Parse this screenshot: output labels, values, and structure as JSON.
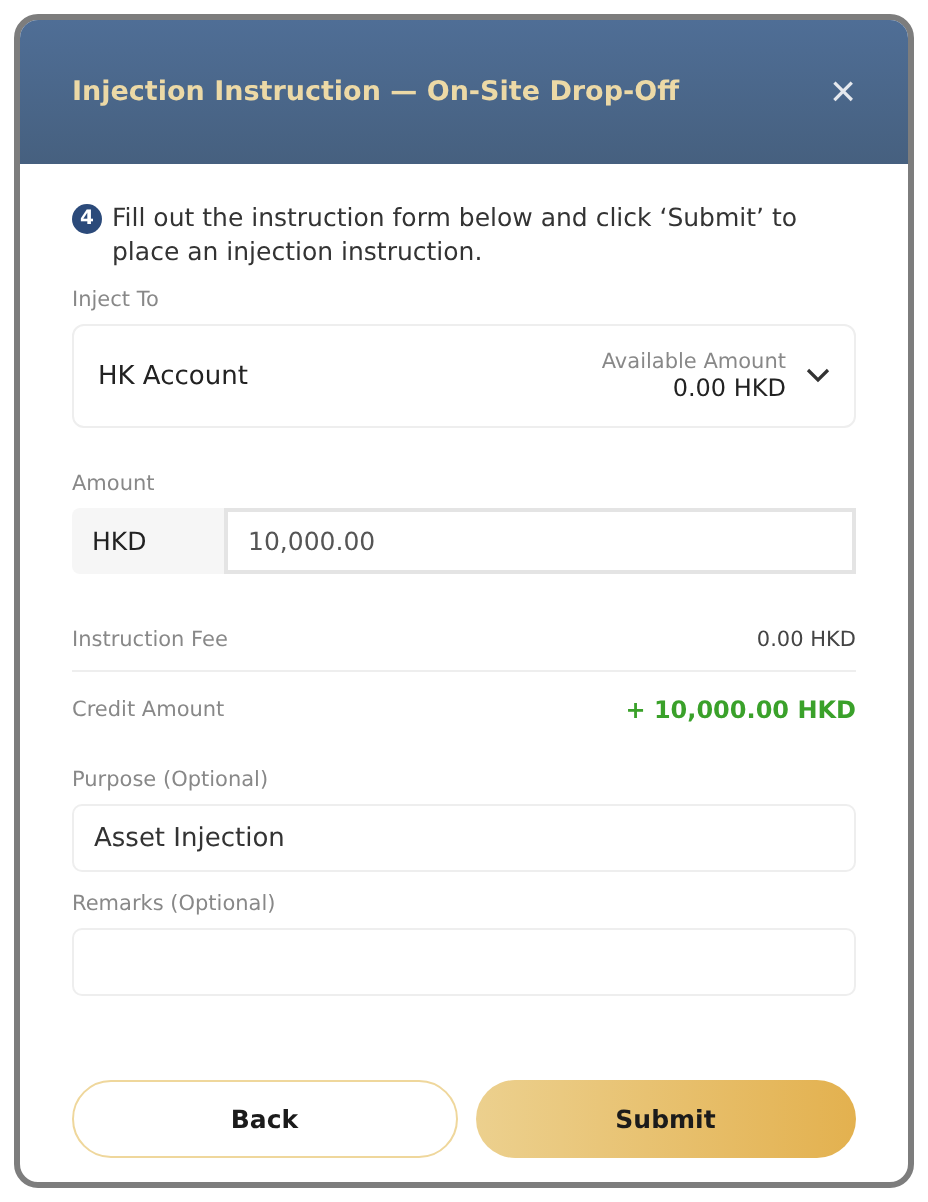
{
  "dialog": {
    "title": "Injection Instruction — On-Site Drop-Off",
    "close": "×"
  },
  "step": {
    "number": "4",
    "text": "Fill out the instruction form below and click ‘Submit’ to place an injection instruction."
  },
  "inject_to": {
    "label": "Inject To",
    "account": "HK Account",
    "available_label": "Available Amount",
    "available_value": "0.00 HKD"
  },
  "amount": {
    "label": "Amount",
    "currency": "HKD",
    "value": "10,000.00"
  },
  "summary": [
    {
      "label": "Instruction Fee",
      "value": "0.00 HKD",
      "kind": "plain"
    },
    {
      "label": "Credit Amount",
      "value": "+ 10,000.00 HKD",
      "kind": "credit"
    }
  ],
  "purpose": {
    "label": "Purpose (Optional)",
    "value": "Asset Injection"
  },
  "remarks": {
    "label": "Remarks (Optional)"
  },
  "buttons": [
    {
      "label": "Back",
      "kind": "secondary"
    },
    {
      "label": "Submit",
      "kind": "primary"
    }
  ]
}
